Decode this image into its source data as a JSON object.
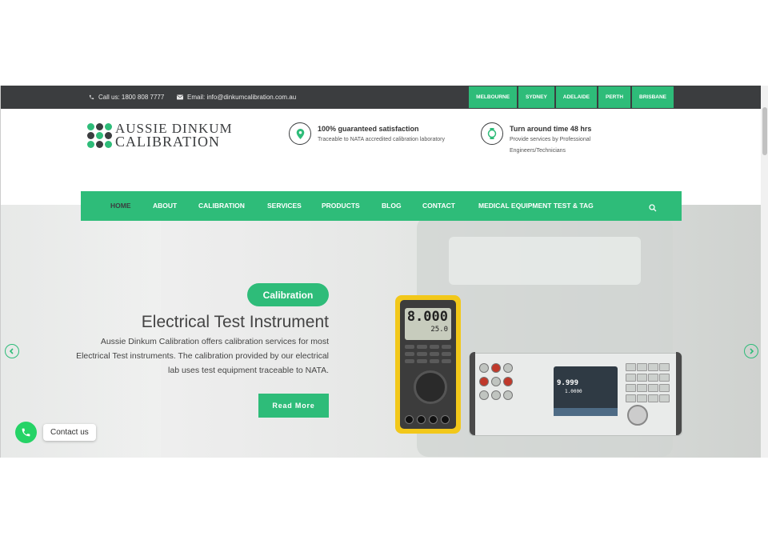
{
  "topbar": {
    "phone": "Call us: 1800 808 7777",
    "email": "Email: info@dinkumcalibration.com.au",
    "cities": [
      "MELBOURNE",
      "SYDNEY",
      "ADELAIDE",
      "PERTH",
      "BRISBANE"
    ]
  },
  "logo": {
    "line1": "AUSSIE DINKUM",
    "line2": "CALIBRATION"
  },
  "features": [
    {
      "icon": "location-pin-icon",
      "title": "100% guaranteed satisfaction",
      "subtitle": "Traceable to NATA accredited calibration laboratory"
    },
    {
      "icon": "watch-icon",
      "title": "Turn around time 48 hrs",
      "subtitle1": "Provide services by Professional",
      "subtitle2": "Engineers/Technicians"
    }
  ],
  "nav": {
    "items": [
      "HOME",
      "ABOUT",
      "CALIBRATION",
      "SERVICES",
      "PRODUCTS",
      "BLOG",
      "CONTACT",
      "MEDICAL EQUIPMENT TEST & TAG"
    ],
    "active": "HOME"
  },
  "hero": {
    "tag": "Calibration",
    "title": "Electrical Test Instrument",
    "desc": "Aussie Dinkum Calibration offers calibration services for most Electrical Test instruments. The calibration provided by our electrical lab uses test equipment traceable to NATA.",
    "button": "Read More",
    "multimeter_reading": "8.000",
    "multimeter_sub": "25.0",
    "calibrator_reading": "9.999",
    "calibrator_sub": "1.0000"
  },
  "contact_widget": {
    "label": "Contact us"
  },
  "colors": {
    "accent": "#2ebc79",
    "topbar": "#3b3d3f",
    "whatsapp": "#25d366"
  }
}
